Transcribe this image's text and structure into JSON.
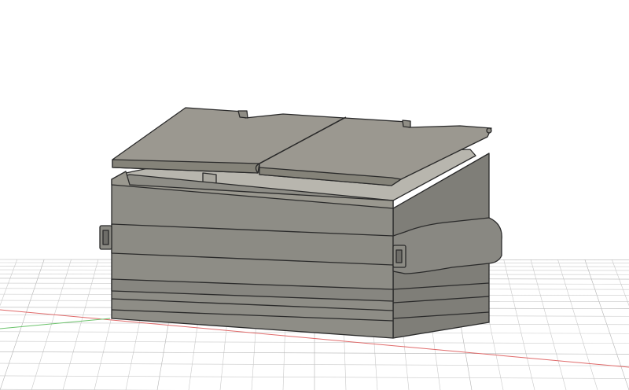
{
  "viewport": {
    "background_color": "#ffffff",
    "grid_line_color": "#c9c9c9",
    "grid_major_color": "#b3b3b3",
    "x_axis_color": "#e06a6a",
    "y_axis_color": "#6cc36c"
  },
  "model": {
    "body_color": "#8e8d86",
    "body_shade_color": "#7f7e78",
    "lid_color": "#9b9890",
    "edge_color": "#2a2a2a",
    "interior_color": "#b8b6ae"
  }
}
